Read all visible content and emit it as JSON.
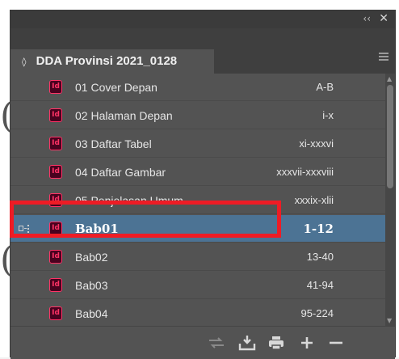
{
  "window": {
    "collapse_glyph": "‹‹",
    "close_glyph": "✕"
  },
  "tab": {
    "sort_glyph": "◊",
    "title": "DDA Provinsi 2021_0128"
  },
  "rows": [
    {
      "name": "01 Cover Depan",
      "pages": "A-B"
    },
    {
      "name": "02 Halaman Depan",
      "pages": "i-x"
    },
    {
      "name": "03 Daftar Tabel",
      "pages": "xi-xxxvi"
    },
    {
      "name": "04 Daftar Gambar",
      "pages": "xxxvii-xxxviii"
    },
    {
      "name": "05 Penjelasan Umum",
      "pages": "xxxix-xlii"
    },
    {
      "name": "Bab01",
      "pages": "1-12"
    },
    {
      "name": "Bab02",
      "pages": "13-40"
    },
    {
      "name": "Bab03",
      "pages": "41-94"
    },
    {
      "name": "Bab04",
      "pages": "95-224"
    }
  ],
  "selected_index": 5,
  "doc_icon_text": "Id",
  "icons": {
    "row_doc": "indesign-document-icon",
    "style_source": "style-source-icon",
    "sync": "synchronize-icon",
    "save": "save-book-icon",
    "print": "print-book-icon",
    "add": "add-document-icon",
    "remove": "remove-document-icon",
    "menu": "panel-menu-icon"
  },
  "colors": {
    "panel": "#535353",
    "selected_row": "#4c7394",
    "indesign_pink": "#ff3366",
    "highlight_red": "#ee1c25"
  }
}
